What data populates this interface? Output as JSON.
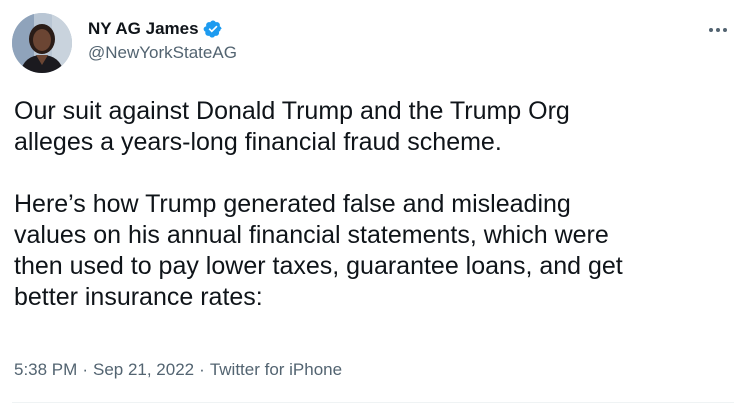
{
  "author": {
    "display_name": "NY AG James",
    "handle": "@NewYorkStateAG",
    "verified": true
  },
  "tweet": {
    "text": "Our suit against Donald Trump and the Trump Org\nalleges a years-long financial fraud scheme.\n\nHere’s how Trump generated false and misleading\nvalues on his annual financial statements, which were\nthen used to pay lower taxes, guarantee loans, and get\nbetter insurance rates:",
    "time": "5:38 PM",
    "separator": "·",
    "date": "Sep 21, 2022",
    "source": "Twitter for iPhone"
  },
  "icons": {
    "verified": "verified-badge-icon",
    "more": "more-options-icon"
  },
  "colors": {
    "text": "#0f1419",
    "secondary": "#536471",
    "verified": "#1d9bf0"
  }
}
